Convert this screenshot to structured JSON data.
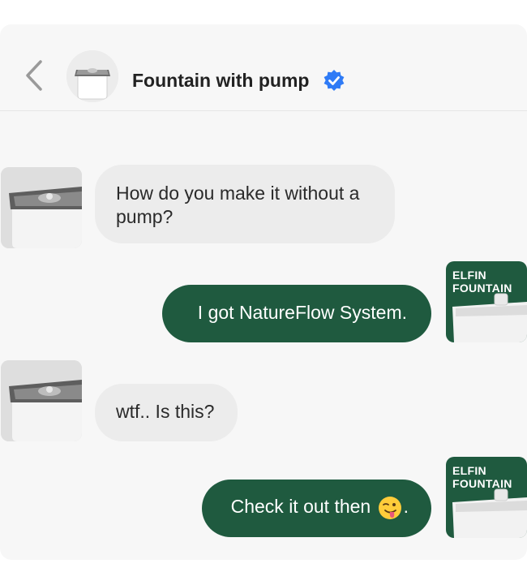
{
  "header": {
    "title": "Fountain with pump",
    "back_icon": "chevron-left-icon",
    "verified_icon": "verified-badge-icon",
    "accent_color": "#2f7bf6"
  },
  "brand": {
    "line1": "ELFIN",
    "line2": "FOUNTAIN"
  },
  "messages": [
    {
      "sender": "other",
      "text": "How do you make it without a pump?"
    },
    {
      "sender": "me",
      "text": "I got NatureFlow System."
    },
    {
      "sender": "other",
      "text": "wtf.. Is this?"
    },
    {
      "sender": "me",
      "text": "Check it out then",
      "emoji": "winking-face-with-tongue-icon",
      "suffix": "."
    }
  ],
  "colors": {
    "outgoing_bubble": "#1f5a3f",
    "incoming_bubble": "#ececec",
    "background": "#f7f7f7"
  }
}
